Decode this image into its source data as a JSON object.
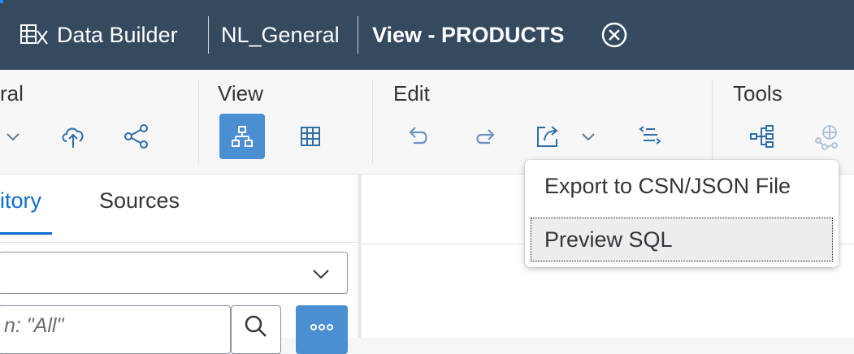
{
  "header": {
    "app_title": "Data Builder",
    "space": "NL_General",
    "view_title": "View - PRODUCTS",
    "icons": [
      "data-builder-icon",
      "close-circle-icon"
    ]
  },
  "toolbar": {
    "groups": [
      {
        "label": "ral",
        "tools": [
          "chevron-down-icon",
          "cloud-upload-icon",
          "share-icon"
        ]
      },
      {
        "label": "View",
        "tools": [
          "hierarchy-icon",
          "table-grid-icon"
        ]
      },
      {
        "label": "Edit",
        "tools": [
          "undo-icon",
          "redo-icon",
          "export-icon",
          "chevron-down-icon",
          "indent-list-icon"
        ]
      },
      {
        "label": "Tools",
        "tools": [
          "impact-lineage-icon",
          "network-icon"
        ]
      }
    ]
  },
  "left_panel": {
    "tabs": [
      {
        "label": "itory",
        "selected": true
      },
      {
        "label": "Sources",
        "selected": false
      }
    ],
    "search_placeholder": "n: \"All\""
  },
  "export_menu": {
    "items": [
      {
        "label": "Export to CSN/JSON File"
      },
      {
        "label": "Preview SQL",
        "focused": true
      }
    ]
  },
  "colors": {
    "header_bg": "#354a5f",
    "accent_blue": "#4a8fd1",
    "selected_tab": "#0a6ed1"
  }
}
